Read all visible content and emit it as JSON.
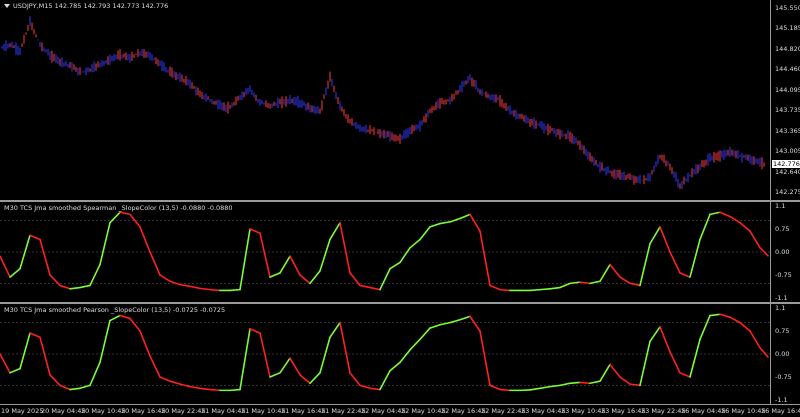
{
  "price_pane": {
    "title": "USDJPY,M15  142.785 142.793 142.773 142.776",
    "current_price": "142.776",
    "axis_labels": [
      "145.550",
      "145.185",
      "144.820",
      "144.460",
      "144.095",
      "143.735",
      "143.365",
      "143.005",
      "142.640",
      "142.275"
    ],
    "colors": {
      "bull": "#2f3aff",
      "bear": "#ff3a3a",
      "background": "#000000"
    }
  },
  "indicator1": {
    "title": "M30 TCS Jma smoothed Spearman _SlopeColor (13,5) -0.0880 -0.0880",
    "axis_labels": [
      "1.1",
      "0.75",
      "0.00",
      "-0.75",
      "-1.1"
    ],
    "colors": {
      "up": "#7cfc3a",
      "down": "#ff2020"
    }
  },
  "indicator2": {
    "title": "M30 TCS Jma smoothed Pearson _SlopeColor (13,5) -0.0725 -0.0725",
    "axis_labels": [
      "1.1",
      "0.75",
      "0.00",
      "-0.75",
      "-1.1"
    ],
    "colors": {
      "up": "#7cfc3a",
      "down": "#ff2020"
    }
  },
  "time_axis": [
    "19 May 2025",
    "20 May 04:45",
    "20 May 10:45",
    "20 May 16:45",
    "20 May 22:45",
    "21 May 04:45",
    "21 May 10:45",
    "21 May 16:45",
    "21 May 22:45",
    "22 May 04:45",
    "22 May 10:45",
    "22 May 16:45",
    "22 May 22:45",
    "23 May 04:45",
    "23 May 10:45",
    "23 May 16:45",
    "23 May 22:45",
    "26 May 04:45",
    "26 May 10:45",
    "26 May 16:45"
  ],
  "chart_data": [
    {
      "type": "line",
      "title": "USDJPY,M15",
      "ylim": [
        142.1,
        145.7
      ],
      "x": [
        0,
        10,
        20,
        30,
        40,
        50,
        60,
        70,
        80,
        90,
        100,
        110,
        120,
        130,
        140,
        150,
        160,
        170,
        180,
        190,
        200,
        210,
        220,
        230,
        240,
        250,
        260,
        270,
        280,
        290,
        300,
        310,
        320,
        330,
        340,
        350,
        360,
        370,
        380,
        390,
        400,
        410,
        420,
        430,
        440,
        450,
        460,
        470,
        480,
        490,
        500,
        510,
        520,
        530,
        540,
        550,
        560,
        570,
        580,
        590,
        600,
        610,
        620,
        630,
        640,
        650,
        660,
        670,
        680,
        690,
        700,
        710,
        720,
        730,
        740,
        750,
        760
      ],
      "values": [
        144.82,
        144.9,
        144.78,
        145.3,
        144.9,
        144.7,
        144.6,
        144.52,
        144.4,
        144.45,
        144.55,
        144.62,
        144.72,
        144.65,
        144.75,
        144.7,
        144.55,
        144.4,
        144.3,
        144.2,
        144.0,
        143.9,
        143.8,
        143.75,
        143.95,
        144.1,
        143.85,
        143.8,
        143.85,
        143.9,
        143.85,
        143.75,
        143.7,
        144.3,
        143.8,
        143.5,
        143.4,
        143.35,
        143.3,
        143.25,
        143.2,
        143.35,
        143.45,
        143.7,
        143.85,
        143.9,
        144.1,
        144.3,
        144.05,
        143.95,
        143.9,
        143.7,
        143.6,
        143.5,
        143.45,
        143.35,
        143.3,
        143.25,
        143.1,
        142.85,
        142.7,
        142.6,
        142.55,
        142.5,
        142.45,
        142.5,
        142.9,
        142.7,
        142.35,
        142.55,
        142.7,
        142.85,
        142.9,
        142.95,
        142.9,
        142.85,
        142.78
      ]
    },
    {
      "type": "line",
      "title": "M30 TCS Jma smoothed Spearman _SlopeColor (13,5)",
      "ylim": [
        -1.1,
        1.1
      ],
      "x": [
        0,
        10,
        20,
        30,
        40,
        50,
        60,
        70,
        80,
        90,
        100,
        110,
        120,
        130,
        140,
        150,
        160,
        170,
        180,
        190,
        200,
        210,
        220,
        230,
        240,
        250,
        260,
        270,
        280,
        290,
        300,
        310,
        320,
        330,
        340,
        350,
        360,
        370,
        380,
        390,
        400,
        410,
        420,
        430,
        440,
        450,
        460,
        470,
        480,
        490,
        500,
        510,
        520,
        530,
        540,
        550,
        560,
        570,
        580,
        590,
        600,
        610,
        620,
        630,
        640,
        650,
        660,
        670,
        680,
        690,
        700,
        710,
        720,
        730,
        740,
        750,
        760,
        768
      ],
      "values": [
        -0.1,
        -0.6,
        -0.4,
        0.4,
        0.3,
        -0.55,
        -0.8,
        -0.88,
        -0.85,
        -0.8,
        -0.3,
        0.7,
        0.95,
        0.9,
        0.6,
        0.0,
        -0.55,
        -0.7,
        -0.78,
        -0.82,
        -0.87,
        -0.9,
        -0.92,
        -0.92,
        -0.9,
        0.55,
        0.45,
        -0.6,
        -0.5,
        -0.1,
        -0.55,
        -0.75,
        -0.45,
        0.3,
        0.7,
        -0.5,
        -0.8,
        -0.85,
        -0.9,
        -0.4,
        -0.25,
        0.1,
        0.3,
        0.6,
        0.68,
        0.72,
        0.8,
        0.9,
        0.5,
        -0.8,
        -0.9,
        -0.92,
        -0.92,
        -0.92,
        -0.9,
        -0.88,
        -0.85,
        -0.75,
        -0.72,
        -0.75,
        -0.7,
        -0.3,
        -0.6,
        -0.75,
        -0.8,
        0.2,
        0.6,
        0.0,
        -0.5,
        -0.6,
        0.3,
        0.9,
        0.95,
        0.85,
        0.7,
        0.5,
        0.1,
        -0.09
      ]
    },
    {
      "type": "line",
      "title": "M30 TCS Jma smoothed Pearson _SlopeColor (13,5)",
      "ylim": [
        -1.1,
        1.1
      ],
      "x": [
        0,
        10,
        20,
        30,
        40,
        50,
        60,
        70,
        80,
        90,
        100,
        110,
        120,
        130,
        140,
        150,
        160,
        170,
        180,
        190,
        200,
        210,
        220,
        230,
        240,
        250,
        260,
        270,
        280,
        290,
        300,
        310,
        320,
        330,
        340,
        350,
        360,
        370,
        380,
        390,
        400,
        410,
        420,
        430,
        440,
        450,
        460,
        470,
        480,
        490,
        500,
        510,
        520,
        530,
        540,
        550,
        560,
        570,
        580,
        590,
        600,
        610,
        620,
        630,
        640,
        650,
        660,
        670,
        680,
        690,
        700,
        710,
        720,
        730,
        740,
        750,
        760,
        768
      ],
      "values": [
        0.0,
        -0.45,
        -0.35,
        0.5,
        0.4,
        -0.5,
        -0.75,
        -0.85,
        -0.82,
        -0.75,
        -0.2,
        0.8,
        0.92,
        0.85,
        0.55,
        -0.05,
        -0.55,
        -0.65,
        -0.72,
        -0.78,
        -0.82,
        -0.85,
        -0.87,
        -0.87,
        -0.85,
        0.6,
        0.5,
        -0.55,
        -0.45,
        -0.1,
        -0.5,
        -0.7,
        -0.45,
        0.4,
        0.75,
        -0.45,
        -0.75,
        -0.82,
        -0.85,
        -0.4,
        -0.2,
        0.1,
        0.35,
        0.62,
        0.7,
        0.75,
        0.82,
        0.9,
        0.55,
        -0.75,
        -0.85,
        -0.87,
        -0.87,
        -0.86,
        -0.82,
        -0.78,
        -0.75,
        -0.7,
        -0.68,
        -0.7,
        -0.65,
        -0.25,
        -0.55,
        -0.72,
        -0.75,
        0.3,
        0.65,
        0.05,
        -0.45,
        -0.55,
        0.35,
        0.92,
        0.95,
        0.88,
        0.75,
        0.55,
        0.15,
        -0.07
      ]
    }
  ]
}
